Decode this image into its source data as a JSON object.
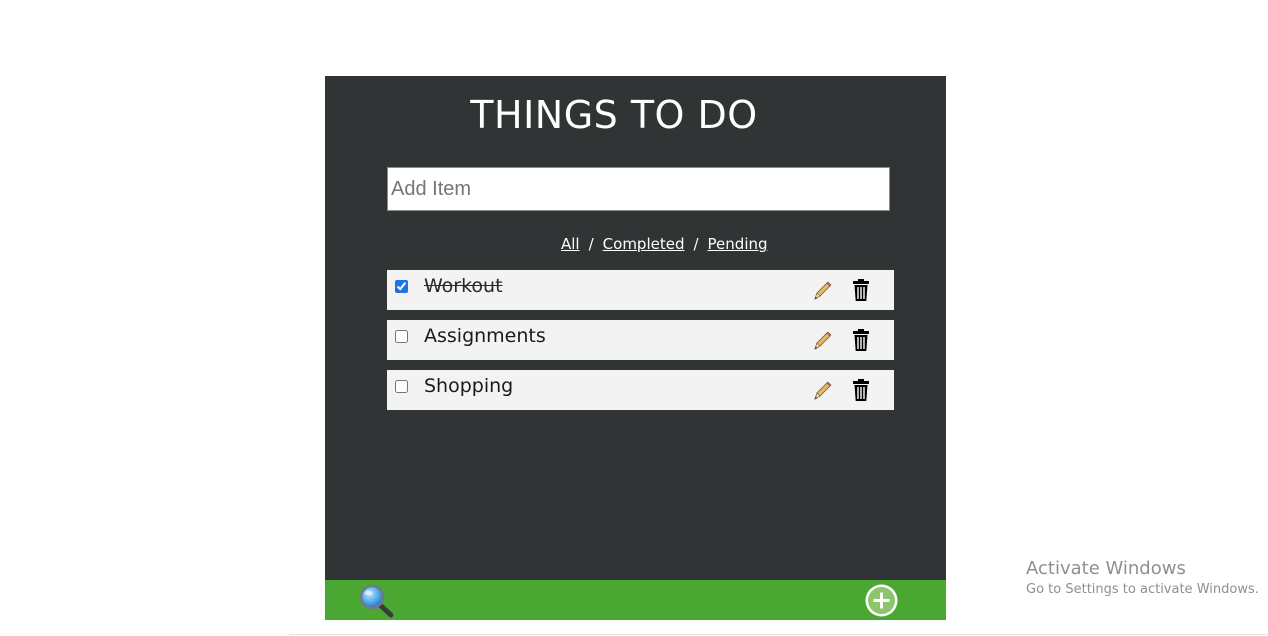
{
  "app": {
    "title": "THINGS TO DO"
  },
  "add_item": {
    "placeholder": "Add Item",
    "value": ""
  },
  "filters": {
    "all_label": "All",
    "completed_label": "Completed",
    "pending_label": "Pending",
    "separator": "/"
  },
  "todos": [
    {
      "text": "Workout",
      "completed": true
    },
    {
      "text": "Assignments",
      "completed": false
    },
    {
      "text": "Shopping",
      "completed": false
    }
  ],
  "icons": {
    "edit": "pencil-icon",
    "delete": "trash-icon",
    "search": "search-icon",
    "add": "plus-circle-icon"
  },
  "colors": {
    "panel_background": "#313435",
    "footer_background": "#4aa832",
    "item_background": "#f3f3f3",
    "text_light": "#ffffff"
  },
  "watermark": {
    "title": "Activate Windows",
    "subtitle": "Go to Settings to activate Windows."
  }
}
